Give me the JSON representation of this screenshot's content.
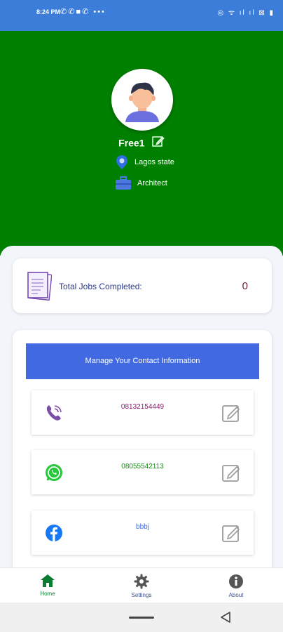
{
  "status_bar": {
    "time": "8:24 PM",
    "left_icons": [
      "whatsapp-icon",
      "phone-icon",
      "image-icon",
      "whatsapp-icon",
      "more-dots-icon"
    ],
    "left_glyphs": "✆✆■✆ •••",
    "right_text": "◎ ᯤ ıl ıl ⊠ ▮"
  },
  "profile": {
    "name": "Free1",
    "location": "Lagos state",
    "profession": "Architect"
  },
  "jobs": {
    "label": "Total Jobs Completed:",
    "count": "0"
  },
  "contact": {
    "header": "Manage Your Contact Information",
    "items": [
      {
        "type": "viber",
        "value": "08132154449",
        "color": "#8b1a6b"
      },
      {
        "type": "whatsapp",
        "value": "08055542113",
        "color": "#1a8a1a"
      },
      {
        "type": "facebook",
        "value": "bbbj",
        "color": "#4169e1"
      }
    ]
  },
  "nav": {
    "items": [
      {
        "label": "Home",
        "icon": "home-icon",
        "active": true
      },
      {
        "label": "Settings",
        "icon": "gear-icon",
        "active": false
      },
      {
        "label": "About",
        "icon": "info-icon",
        "active": false
      }
    ]
  },
  "colors": {
    "hero": "#008000",
    "accent": "#4169e1",
    "active_nav": "#0a7d32"
  }
}
